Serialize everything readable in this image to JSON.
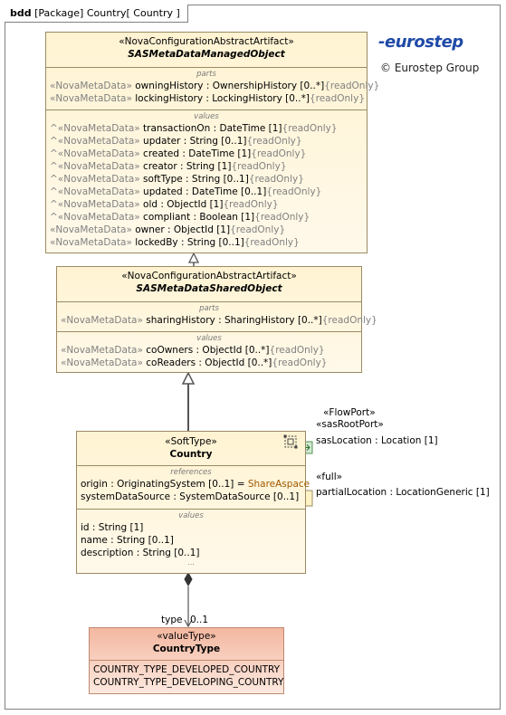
{
  "frame": {
    "kind": "bdd",
    "package": "[Package]",
    "name": "Country",
    "diagram": "[ Country ]"
  },
  "logo": {
    "text": "eurostep",
    "copyright": "© Eurostep Group"
  },
  "managed": {
    "stereotype": "«NovaConfigurationAbstractArtifact»",
    "name": "SASMetaDataManagedObject",
    "parts_title": "parts",
    "parts": [
      {
        "prefix": "«NovaMetaData»",
        "text": " owningHistory : OwnershipHistory [0..*]",
        "ro": "{readOnly}"
      },
      {
        "prefix": "«NovaMetaData»",
        "text": " lockingHistory : LockingHistory [0..*]",
        "ro": "{readOnly}"
      }
    ],
    "values_title": "values",
    "values": [
      {
        "prefix": "^«NovaMetaData»",
        "text": " transactionOn : DateTime [1]",
        "ro": "{readOnly}"
      },
      {
        "prefix": "^«NovaMetaData»",
        "text": " updater : String [0..1]",
        "ro": "{readOnly}"
      },
      {
        "prefix": "^«NovaMetaData»",
        "text": " created : DateTime [1]",
        "ro": "{readOnly}"
      },
      {
        "prefix": "^«NovaMetaData»",
        "text": " creator : String [1]",
        "ro": "{readOnly}"
      },
      {
        "prefix": "^«NovaMetaData»",
        "text": " softType : String [0..1]",
        "ro": "{readOnly}"
      },
      {
        "prefix": "^«NovaMetaData»",
        "text": " updated : DateTime [0..1]",
        "ro": "{readOnly}"
      },
      {
        "prefix": "^«NovaMetaData»",
        "text": " old : ObjectId [1]",
        "ro": "{readOnly}"
      },
      {
        "prefix": "^«NovaMetaData»",
        "text": " compliant : Boolean [1]",
        "ro": "{readOnly}"
      },
      {
        "prefix": "«NovaMetaData»",
        "text": " owner : ObjectId [1]",
        "ro": "{readOnly}"
      },
      {
        "prefix": "«NovaMetaData»",
        "text": " lockedBy : String [0..1]",
        "ro": "{readOnly}"
      }
    ]
  },
  "shared": {
    "stereotype": "«NovaConfigurationAbstractArtifact»",
    "name": "SASMetaDataSharedObject",
    "parts_title": "parts",
    "parts": [
      {
        "prefix": "«NovaMetaData»",
        "text": " sharingHistory : SharingHistory [0..*]",
        "ro": "{readOnly}"
      }
    ],
    "values_title": "values",
    "values": [
      {
        "prefix": "«NovaMetaData»",
        "text": " coOwners : ObjectId [0..*]",
        "ro": "{readOnly}"
      },
      {
        "prefix": "«NovaMetaData»",
        "text": " coReaders : ObjectId [0..*]",
        "ro": "{readOnly}"
      }
    ]
  },
  "country": {
    "stereotype": "«SoftType»",
    "name": "Country",
    "references_title": "references",
    "references": [
      {
        "text": "origin : OriginatingSystem [0..1] = ",
        "default": "ShareAspace"
      },
      {
        "text": "systemDataSource : SystemDataSource [0..1]",
        "default": ""
      }
    ],
    "values_title": "values",
    "values": [
      {
        "text": "id : String [1]"
      },
      {
        "text": "name : String [0..1]"
      },
      {
        "text": "description : String [0..1]"
      }
    ],
    "ellipsis": "..."
  },
  "ports": {
    "flow_stereo1": "«FlowPort»",
    "flow_stereo2": "«sasRootPort»",
    "flow_label": "sasLocation : Location [1]",
    "full_stereo": "«full»",
    "full_label": "partialLocation : LocationGeneric [1]"
  },
  "association": {
    "role": "type",
    "multiplicity": "0..1"
  },
  "countryType": {
    "stereotype": "«valueType»",
    "name": "CountryType",
    "literals": [
      "COUNTRY_TYPE_DEVELOPED_COUNTRY",
      "COUNTRY_TYPE_DEVELOPING_COUNTRY"
    ]
  },
  "colors": {
    "block_fill": "#fff3d2",
    "block_border": "#9c8a63",
    "value_fill": "#f3b7a0",
    "logo_blue": "#1f4aa8",
    "port_green": "#9ad09a"
  }
}
